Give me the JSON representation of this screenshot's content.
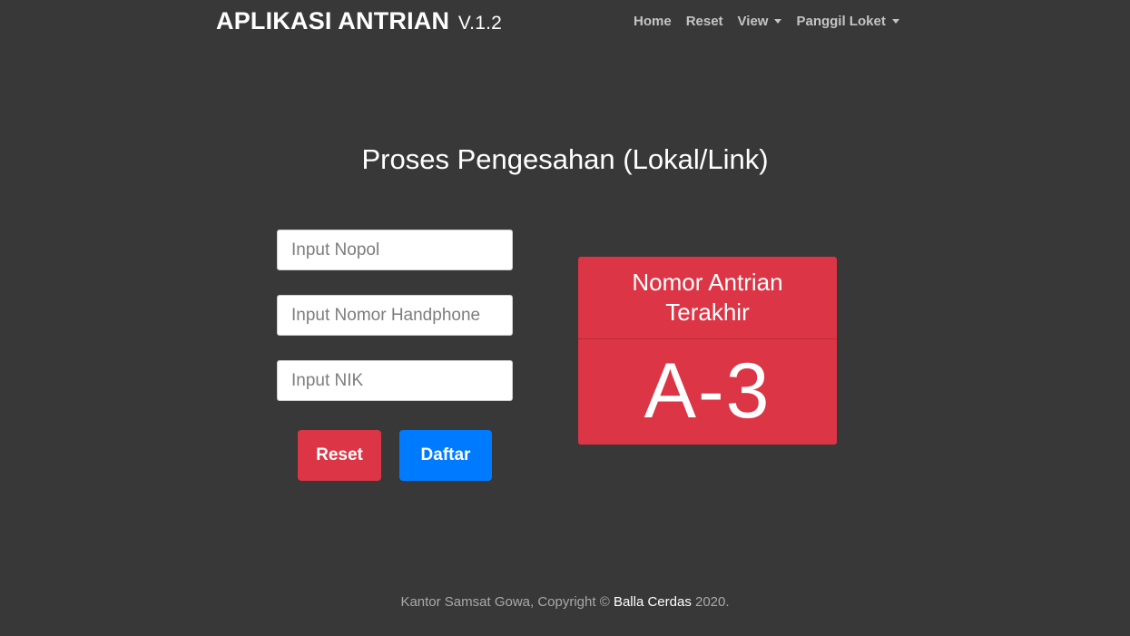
{
  "navbar": {
    "brand": "APLIKASI ANTRIAN",
    "version": "V.1.2",
    "items": [
      {
        "label": "Home"
      },
      {
        "label": "Reset"
      },
      {
        "label": "View",
        "dropdown": true
      },
      {
        "label": "Panggil Loket",
        "dropdown": true
      }
    ]
  },
  "main": {
    "title": "Proses Pengesahan (Lokal/Link)"
  },
  "form": {
    "nopol_placeholder": "Input Nopol",
    "hp_placeholder": "Input Nomor Handphone",
    "nik_placeholder": "Input NIK",
    "reset_label": "Reset",
    "daftar_label": "Daftar"
  },
  "queue_card": {
    "title": "Nomor Antrian Terakhir",
    "number": "A-3"
  },
  "footer": {
    "text": "Kantor Samsat Gowa, Copyright ©",
    "link": "Balla Cerdas",
    "year": "2020."
  },
  "colors": {
    "background": "#383838",
    "danger": "#dc3545",
    "primary": "#007bff",
    "nav_text": "#c4c4c4"
  }
}
